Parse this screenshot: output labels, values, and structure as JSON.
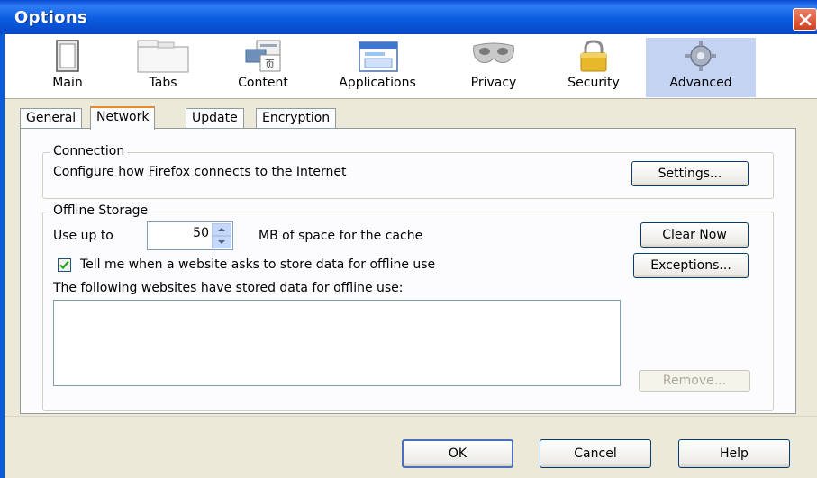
{
  "window": {
    "title": "Options"
  },
  "panes": [
    {
      "label": "Main",
      "icon": "main-window-icon"
    },
    {
      "label": "Tabs",
      "icon": "tabs-icon"
    },
    {
      "label": "Content",
      "icon": "content-icon"
    },
    {
      "label": "Applications",
      "icon": "applications-icon"
    },
    {
      "label": "Privacy",
      "icon": "privacy-mask-icon"
    },
    {
      "label": "Security",
      "icon": "padlock-icon"
    },
    {
      "label": "Advanced",
      "icon": "gear-icon"
    }
  ],
  "selected_pane": "Advanced",
  "tabs": [
    "General",
    "Network",
    "Update",
    "Encryption"
  ],
  "active_tab": "Network",
  "connection": {
    "legend": "Connection",
    "description": "Configure how Firefox connects to the Internet",
    "settings_label": "Settings..."
  },
  "offline": {
    "legend": "Offline Storage",
    "use_up_to": "Use up to",
    "cache_value": "50",
    "cache_unit": "MB of space for the cache",
    "clear_now_label": "Clear Now",
    "tell_me_label": "Tell me when a website asks to store data for offline use",
    "tell_me_checked": true,
    "exceptions_label": "Exceptions...",
    "list_caption": "The following websites have stored data for offline use:",
    "remove_label": "Remove..."
  },
  "footer": {
    "ok_label": "OK",
    "cancel_label": "Cancel",
    "help_label": "Help"
  },
  "colors": {
    "titlebar": "#0b5ce0",
    "close_button": "#d2401e",
    "dialog_bg": "#ece9d8",
    "selected_pane_bg": "#c5d3f3",
    "active_tab_accent": "#e68b2c"
  }
}
